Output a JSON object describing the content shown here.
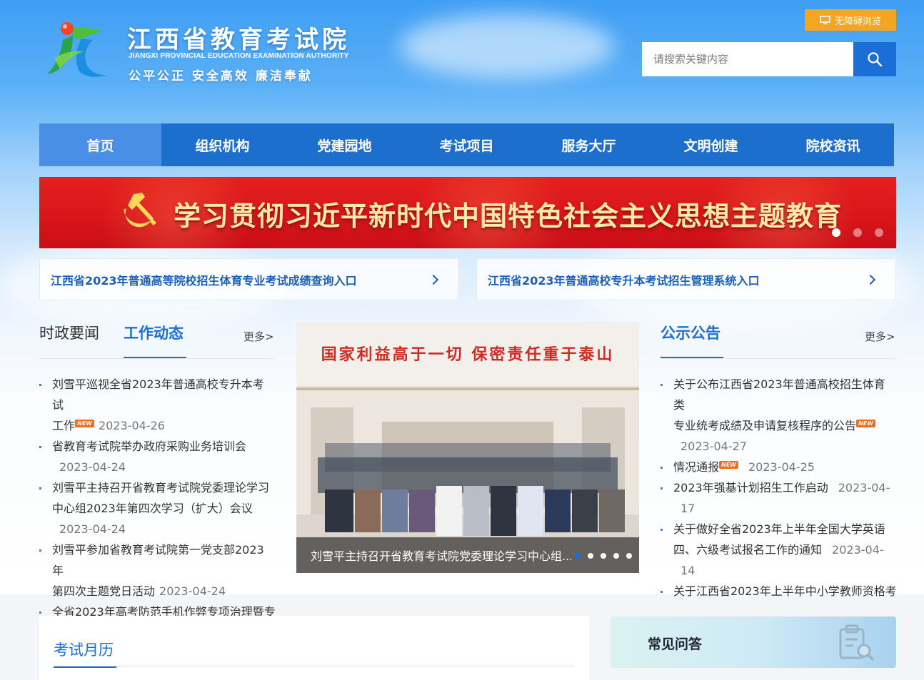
{
  "header": {
    "title": "江西省教育考试院",
    "title_en": "JIANGXI PROVINCIAL EDUCATION EXAMINATION AUTHORITY",
    "slogan": "公平公正  安全高效  廉洁奉献",
    "accessibility_label": "无障碍浏览",
    "search_placeholder": "请搜索关键内容"
  },
  "nav": {
    "items": [
      "首页",
      "组织机构",
      "党建园地",
      "考试项目",
      "服务大厅",
      "文明创建",
      "院校资讯"
    ],
    "active_index": 0
  },
  "banner": {
    "text": "学习贯彻习近平新时代中国特色社会主义思想主题教育",
    "slide_count": 3,
    "active_slide": 1
  },
  "quick_links": [
    "江西省2023年普通高等院校招生体育专业考试成绩查询入口",
    "江西省2023年普通高校专升本考试招生管理系统入口"
  ],
  "news": {
    "tab_inactive": "时政要闻",
    "tab_active": "工作动态",
    "more": "更多>",
    "new_label": "NEW",
    "items": [
      {
        "title_a": "刘雪平巡视全省2023年普通高校专升本考试",
        "title_b": "工作",
        "date": "2023-04-26"
      },
      {
        "title": "省教育考试院举办政府采购业务培训会",
        "date": "2023-04-24"
      },
      {
        "title_a": "刘雪平主持召开省教育考试院党委理论学习",
        "title_b": "中心组2023年第四次学习（扩大）会议",
        "date": "2023-04-24"
      },
      {
        "title_a": "刘雪平参加省教育考试院第一党支部2023年",
        "title_b": "第四次主题党日活动",
        "date": "2023-04-24"
      },
      {
        "title": "全省2023年高考防范手机作弊专项治理暨专·"
      }
    ]
  },
  "photo": {
    "sign_text": "国家利益高于一切  保密责任重于泰山",
    "caption": "刘雪平主持召开省教育考试院党委理论学习中心组...",
    "slide_count": 5,
    "active_slide": 1
  },
  "announcements": {
    "tab": "公示公告",
    "more": "更多>",
    "items": [
      {
        "title_a": "关于公布江西省2023年普通高校招生体育类",
        "title_b": "专业统考成绩及申请复核程序的公告",
        "date": "2023-04-27"
      },
      {
        "title": "情况通报",
        "date": "2023-04-25"
      },
      {
        "title": "2023年强基计划招生工作启动",
        "date_a": "2023-04-",
        "date_b": "17"
      },
      {
        "title_a": "关于做好全省2023年上半年全国大学英语",
        "title_b": "四、六级考试报名工作的通知",
        "date_a": "2023-04-",
        "date_b": "14"
      },
      {
        "title": "关于江西省2023年上半年中小学教师资格考·"
      }
    ]
  },
  "calendar": {
    "title": "考试月历"
  },
  "faq": {
    "title": "常见问答"
  },
  "colors": {
    "primary": "#1d6fce",
    "nav_active": "#4a8fe6",
    "accent": "#f5a524",
    "banner_red": "#e4211d"
  }
}
